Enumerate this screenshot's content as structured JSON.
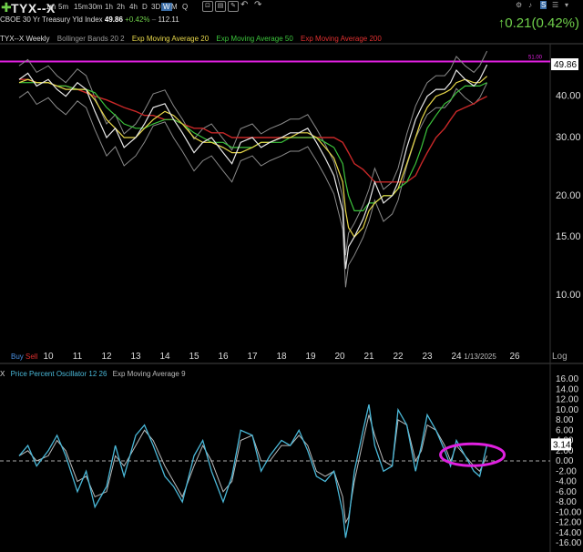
{
  "header": {
    "symbol": "TYX--X",
    "timeframes": [
      "1m",
      "5m",
      "15m",
      "30m",
      "1h",
      "2h",
      "4h",
      "D",
      "3D",
      "W",
      "M",
      "Q"
    ],
    "selected_timeframe": "W",
    "description": "CBOE 30 Yr Treasury Yld Index",
    "last": "49.86",
    "change_pct": "+0.42%",
    "volume": "112.11",
    "big_change": "↑0.21(0.42%)"
  },
  "indicators": {
    "main_title": "TYX--X Weekly",
    "items": [
      {
        "label": "Bollinger Bands 20 2",
        "color": "#9a9a9a"
      },
      {
        "label": "Exp Moving Average 20",
        "color": "#e8d84a"
      },
      {
        "label": "Exp Moving Average 50",
        "color": "#3cc43c"
      },
      {
        "label": "Exp Moving Average 200",
        "color": "#c82828"
      }
    ],
    "lower_title_x": "X",
    "lower_items": [
      {
        "label": "Price Percent Oscillator 12 26",
        "color": "#4ab8d8"
      },
      {
        "label": "Exp Moving Average 9",
        "color": "#bbbbbb"
      }
    ]
  },
  "controls": {
    "buy": "Buy",
    "sell": "Sell",
    "log": "Log"
  },
  "chart_data": [
    {
      "type": "line",
      "title": "TYX--X Weekly",
      "price_scale": "log",
      "ylim": [
        7.0,
        57.0
      ],
      "y_ticks": [
        "10.00",
        "15.00",
        "20.00",
        "30.00",
        "40.00"
      ],
      "x_labels": [
        "10",
        "11",
        "12",
        "13",
        "14",
        "15",
        "16",
        "17",
        "18",
        "19",
        "20",
        "21",
        "22",
        "23",
        "24",
        "1/13/2025",
        "26"
      ],
      "last_price_label": "49.86",
      "resistance_label": "51.00",
      "resistance_value": 51.0,
      "resistance_color": "#e020e0",
      "x": [
        2009.0,
        2009.3,
        2009.6,
        2010.0,
        2010.3,
        2010.6,
        2011.0,
        2011.3,
        2011.6,
        2012.0,
        2012.3,
        2012.6,
        2013.0,
        2013.3,
        2013.6,
        2014.0,
        2014.3,
        2014.6,
        2015.0,
        2015.3,
        2015.6,
        2016.0,
        2016.3,
        2016.6,
        2017.0,
        2017.3,
        2017.6,
        2018.0,
        2018.3,
        2018.6,
        2018.9,
        2019.2,
        2019.5,
        2019.8,
        2020.1,
        2020.2,
        2020.3,
        2020.5,
        2020.8,
        2021.0,
        2021.2,
        2021.5,
        2021.8,
        2022.0,
        2022.3,
        2022.6,
        2022.8,
        2023.0,
        2023.3,
        2023.6,
        2023.8,
        2024.0,
        2024.3,
        2024.6,
        2024.8,
        2025.05
      ],
      "series": [
        {
          "name": "TYX--X",
          "color": "#e8e8e8",
          "values": [
            45,
            47,
            43,
            45,
            42,
            40,
            44,
            42,
            36,
            30,
            32,
            28,
            30,
            33,
            37,
            38,
            34,
            31,
            27,
            29,
            30,
            27,
            25,
            29,
            30,
            28,
            29,
            30,
            31,
            31,
            32,
            29,
            26,
            23,
            18,
            12,
            14,
            15,
            17,
            19,
            22,
            19,
            20,
            22,
            28,
            34,
            37,
            40,
            42,
            42,
            44,
            48,
            45,
            43,
            45,
            49.86
          ]
        },
        {
          "name": "Exp Moving Average 20",
          "color": "#e8d84a",
          "values": [
            44,
            45,
            44,
            44,
            43,
            42,
            42,
            42,
            39,
            34,
            32,
            30,
            30,
            32,
            34,
            36,
            35,
            33,
            30,
            29,
            29,
            28,
            27,
            27,
            28,
            29,
            29,
            30,
            30,
            31,
            31,
            30,
            28,
            26,
            22,
            18,
            16,
            15,
            16,
            18,
            19,
            20,
            20,
            21,
            25,
            30,
            34,
            37,
            40,
            41,
            42,
            44,
            45,
            44,
            44,
            46
          ]
        },
        {
          "name": "Exp Moving Average 50",
          "color": "#3cc43c",
          "values": [
            44,
            44,
            44,
            44,
            43,
            43,
            42,
            42,
            41,
            37,
            35,
            33,
            32,
            32,
            33,
            34,
            34,
            33,
            31,
            30,
            29,
            29,
            28,
            28,
            28,
            29,
            29,
            29,
            30,
            30,
            30,
            30,
            29,
            28,
            25,
            22,
            20,
            18,
            18,
            19,
            19,
            20,
            20,
            21,
            22,
            25,
            28,
            32,
            35,
            38,
            39,
            41,
            43,
            43,
            43,
            44
          ]
        },
        {
          "name": "Exp Moving Average 200",
          "color": "#c82828",
          "values": [
            45,
            45,
            44,
            44,
            43,
            43,
            42,
            41,
            40,
            39,
            38,
            37,
            36,
            35,
            35,
            34,
            34,
            33,
            32,
            32,
            31,
            31,
            30,
            30,
            30,
            30,
            30,
            30,
            30,
            30,
            30,
            30,
            30,
            30,
            29,
            28,
            27,
            25,
            24,
            23,
            22,
            22,
            22,
            22,
            22,
            23,
            25,
            27,
            30,
            32,
            34,
            36,
            37,
            38,
            39,
            40
          ]
        }
      ]
    },
    {
      "type": "line",
      "title": "Price Percent Oscillator 12 26",
      "ylim": [
        -16.0,
        16.0
      ],
      "y_ticks": [
        "16.00",
        "14.00",
        "12.00",
        "10.00",
        "8.00",
        "6.00",
        "4.00",
        "2.00",
        "0.00",
        "-2.00",
        "-4.00",
        "-6.00",
        "-8.00",
        "-10.00",
        "-12.00",
        "-14.00",
        "-16.00"
      ],
      "last_value_label": "3.14",
      "x": [
        2009.0,
        2009.3,
        2009.6,
        2010.0,
        2010.3,
        2010.6,
        2011.0,
        2011.3,
        2011.6,
        2012.0,
        2012.3,
        2012.6,
        2013.0,
        2013.3,
        2013.6,
        2014.0,
        2014.3,
        2014.6,
        2015.0,
        2015.3,
        2015.6,
        2016.0,
        2016.3,
        2016.6,
        2017.0,
        2017.3,
        2017.6,
        2018.0,
        2018.3,
        2018.6,
        2018.9,
        2019.2,
        2019.5,
        2019.8,
        2020.1,
        2020.2,
        2020.3,
        2020.5,
        2020.8,
        2021.0,
        2021.2,
        2021.5,
        2021.8,
        2022.0,
        2022.3,
        2022.6,
        2022.8,
        2023.0,
        2023.3,
        2023.6,
        2023.8,
        2024.0,
        2024.3,
        2024.6,
        2024.8,
        2025.05
      ],
      "series": [
        {
          "name": "Price Percent Oscillator 12 26",
          "color": "#4ab8d8",
          "values": [
            1,
            3,
            -1,
            2,
            5,
            1,
            -6,
            -2,
            -9,
            -5,
            3,
            -3,
            5,
            7,
            3,
            -3,
            -5,
            -8,
            1,
            4,
            -2,
            -8,
            -3,
            6,
            5,
            -2,
            1,
            4,
            3,
            6,
            2,
            -3,
            -4,
            -2,
            -10,
            -15,
            -12,
            -2,
            6,
            11,
            3,
            -2,
            -1,
            10,
            7,
            -2,
            3,
            9,
            6,
            2,
            -1,
            4,
            1,
            -2,
            -3,
            3.14
          ]
        },
        {
          "name": "Exp Moving Average 9",
          "color": "#bbbbbb",
          "values": [
            1,
            2,
            0,
            1,
            4,
            2,
            -4,
            -3,
            -7,
            -6,
            1,
            -1,
            3,
            6,
            4,
            -1,
            -4,
            -7,
            -1,
            3,
            0,
            -6,
            -4,
            4,
            5,
            0,
            0,
            3,
            3,
            5,
            3,
            -2,
            -3,
            -2,
            -7,
            -12,
            -11,
            -4,
            4,
            9,
            5,
            0,
            -1,
            8,
            7,
            0,
            2,
            7,
            6,
            3,
            0,
            3,
            1,
            -1,
            -2,
            1
          ]
        }
      ],
      "highlight": {
        "shape": "ellipse",
        "color": "#e020e0"
      }
    }
  ]
}
